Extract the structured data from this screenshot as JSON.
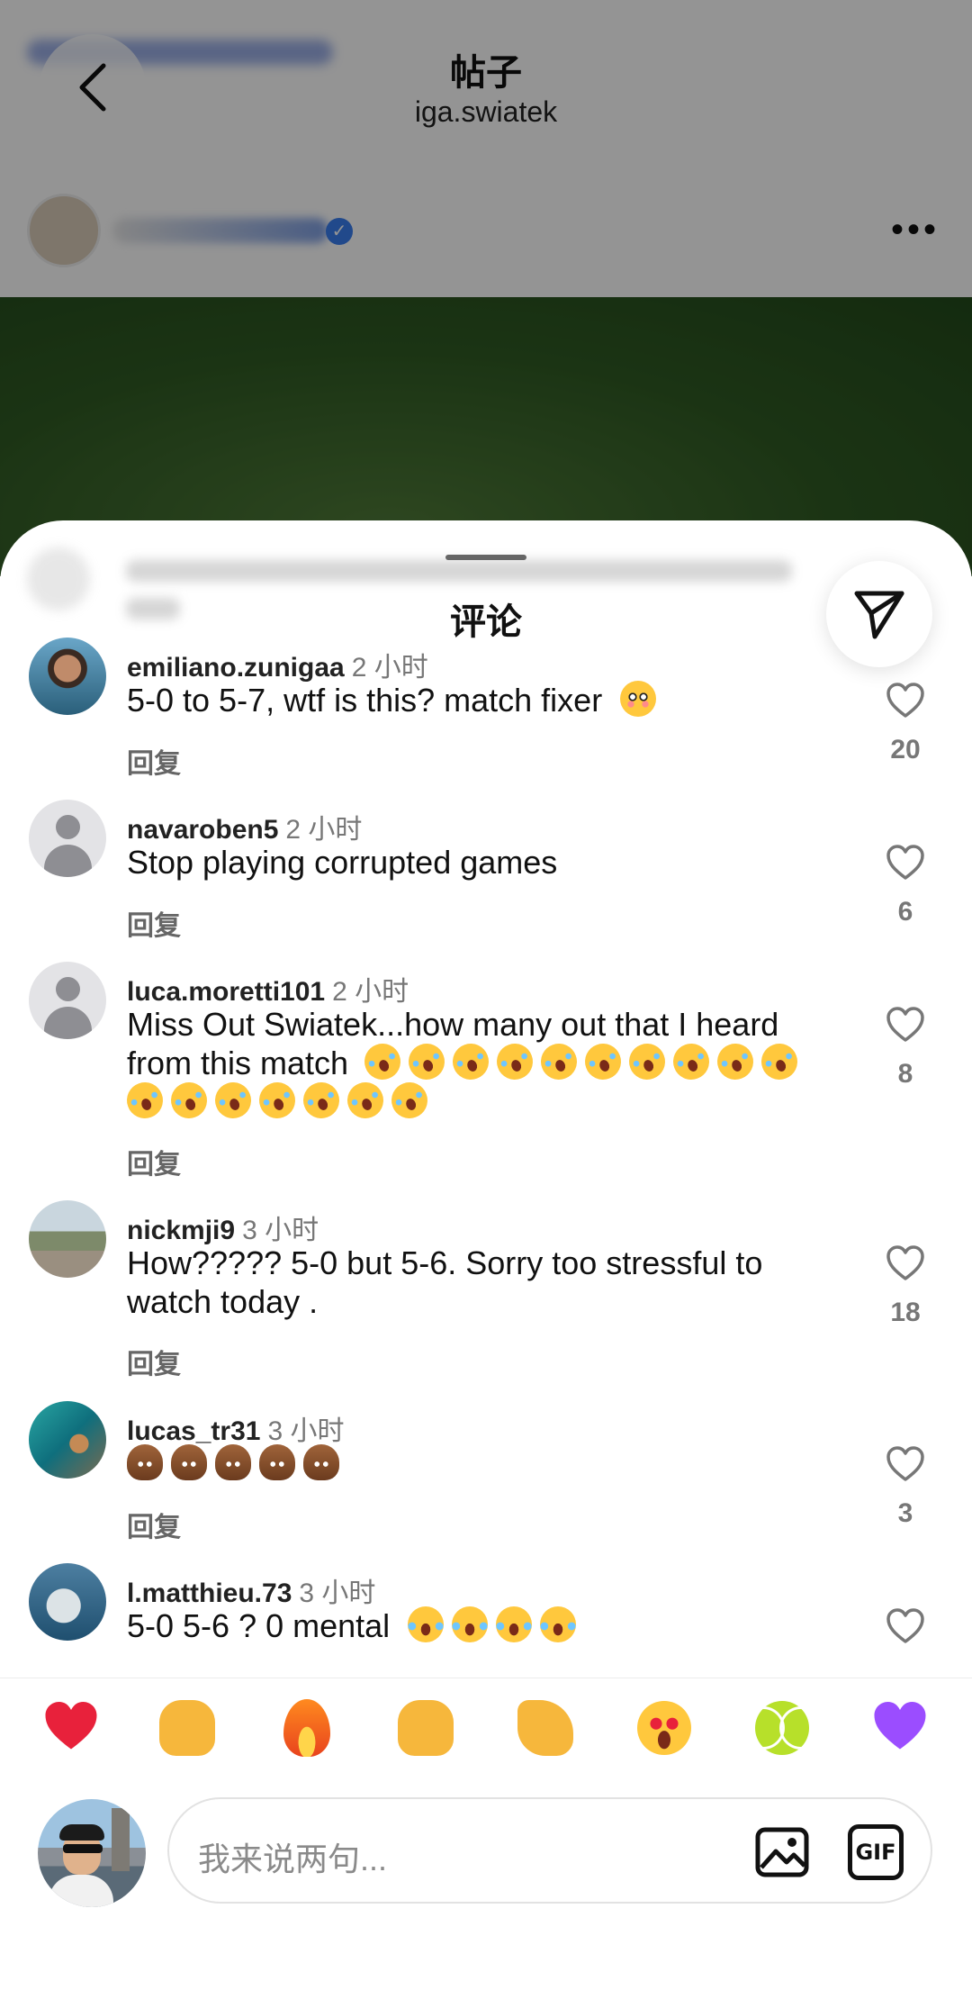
{
  "post": {
    "title": "帖子",
    "author": "iga.swiatek"
  },
  "sheet": {
    "title": "评论"
  },
  "comments": [
    {
      "username": "emiliano.zunigaa",
      "time": "2 小时",
      "text": "5-0 to 5-7, wtf is this? match fixer",
      "emojis": [
        "flushed"
      ],
      "reply": "回复",
      "likes": "20",
      "avatar": "photo-avatar"
    },
    {
      "username": "navaroben5",
      "time": "2 小时",
      "text": "Stop playing corrupted games",
      "emojis": [],
      "reply": "回复",
      "likes": "6",
      "avatar": "default-avatar"
    },
    {
      "username": "luca.moretti101",
      "time": "2 小时",
      "text": "Miss Out Swiatek...how many out that I heard from this match",
      "emojis": [
        "rofl",
        "rofl",
        "rofl",
        "rofl",
        "rofl",
        "rofl",
        "rofl",
        "rofl",
        "rofl",
        "rofl",
        "rofl",
        "rofl",
        "rofl",
        "rofl",
        "rofl",
        "rofl",
        "rofl"
      ],
      "reply": "回复",
      "likes": "8",
      "avatar": "default-avatar"
    },
    {
      "username": "nickmji9",
      "time": "3 小时",
      "text": "How????? 5-0 but 5-6. Sorry too stressful to watch today .",
      "emojis": [],
      "reply": "回复",
      "likes": "18",
      "avatar": "road-photo-avatar"
    },
    {
      "username": "lucas_tr31",
      "time": "3 小时",
      "text": "",
      "emojis": [
        "poo",
        "poo",
        "poo",
        "poo",
        "poo"
      ],
      "reply": "回复",
      "likes": "3",
      "avatar": "sea-photo-avatar"
    },
    {
      "username": "l.matthieu.73",
      "time": "3 小时",
      "text": "5-0 5-6 ? 0 mental",
      "emojis": [
        "joy",
        "joy",
        "joy",
        "joy"
      ],
      "reply": "回复",
      "likes": "",
      "avatar": "shark-photo-avatar"
    }
  ],
  "reactions": [
    "red-heart",
    "raising-hands",
    "fire",
    "clapping-hands",
    "flexed-biceps",
    "heart-eyes",
    "tennis-ball",
    "purple-heart"
  ],
  "input": {
    "placeholder": "我来说两句...",
    "gif_label": "GIF"
  },
  "colors": {
    "like_count": "#777777",
    "red_heart": "#e8213b",
    "purple_heart": "#9b4dff",
    "verified": "#3a7ff0"
  }
}
